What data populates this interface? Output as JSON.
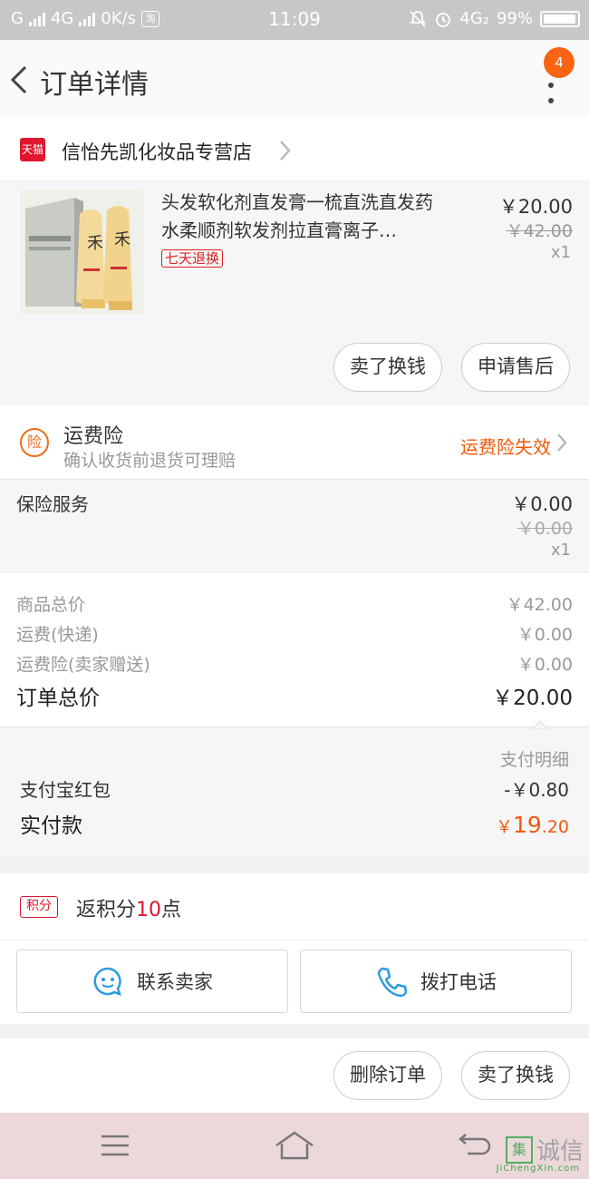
{
  "status_bar": {
    "carrier1": "G",
    "carrier2": "4G",
    "speed": "0K/s",
    "taobao_badge": "淘",
    "time": "11:09",
    "network": "4G₂",
    "battery": "99%"
  },
  "header": {
    "title": "订单详情",
    "notification_count": "4"
  },
  "store": {
    "badge": "天猫",
    "name": "信怡先凯化妆品专营店"
  },
  "product": {
    "title": "头发软化剂直发膏一梳直洗直发药水柔顺剂软发剂拉直膏离子…",
    "tag": "七天退换",
    "price": "￥20.00",
    "original_price": "￥42.00",
    "quantity": "x1",
    "buttons": {
      "sell_exchange": "卖了换钱",
      "after_sale": "申请售后"
    }
  },
  "insurance": {
    "icon_char": "险",
    "title": "运费险",
    "subtitle": "确认收货前退货可理赔",
    "status": "运费险失效"
  },
  "service": {
    "label": "保险服务",
    "price": "￥0.00",
    "original_price": "￥0.00",
    "quantity": "x1"
  },
  "totals": {
    "rows": [
      {
        "label": "商品总价",
        "value": "￥42.00"
      },
      {
        "label": "运费(快递)",
        "value": "￥0.00"
      },
      {
        "label": "运费险(卖家赠送)",
        "value": "￥0.00"
      }
    ],
    "order_total_label": "订单总价",
    "order_total_value": "￥20.00"
  },
  "payment": {
    "detail_label": "支付明细",
    "red_packet_label": "支付宝红包",
    "red_packet_value": "-￥0.80",
    "paid_label": "实付款",
    "paid_symbol": "￥",
    "paid_int": "19",
    "paid_dec": ".20"
  },
  "points": {
    "badge": "积分",
    "prefix": "返积分",
    "number": "10",
    "suffix": "点"
  },
  "contact": {
    "seller": "联系卖家",
    "call": "拨打电话"
  },
  "order_actions": {
    "delete": "删除订单",
    "sell_exchange": "卖了换钱"
  },
  "watermark": {
    "box": "集",
    "text": "诚信",
    "sub": "JiChengXin.com"
  },
  "colors": {
    "accent_orange": "#f05a0a",
    "tmall_red": "#e0152e",
    "badge_orange": "#f86412"
  }
}
